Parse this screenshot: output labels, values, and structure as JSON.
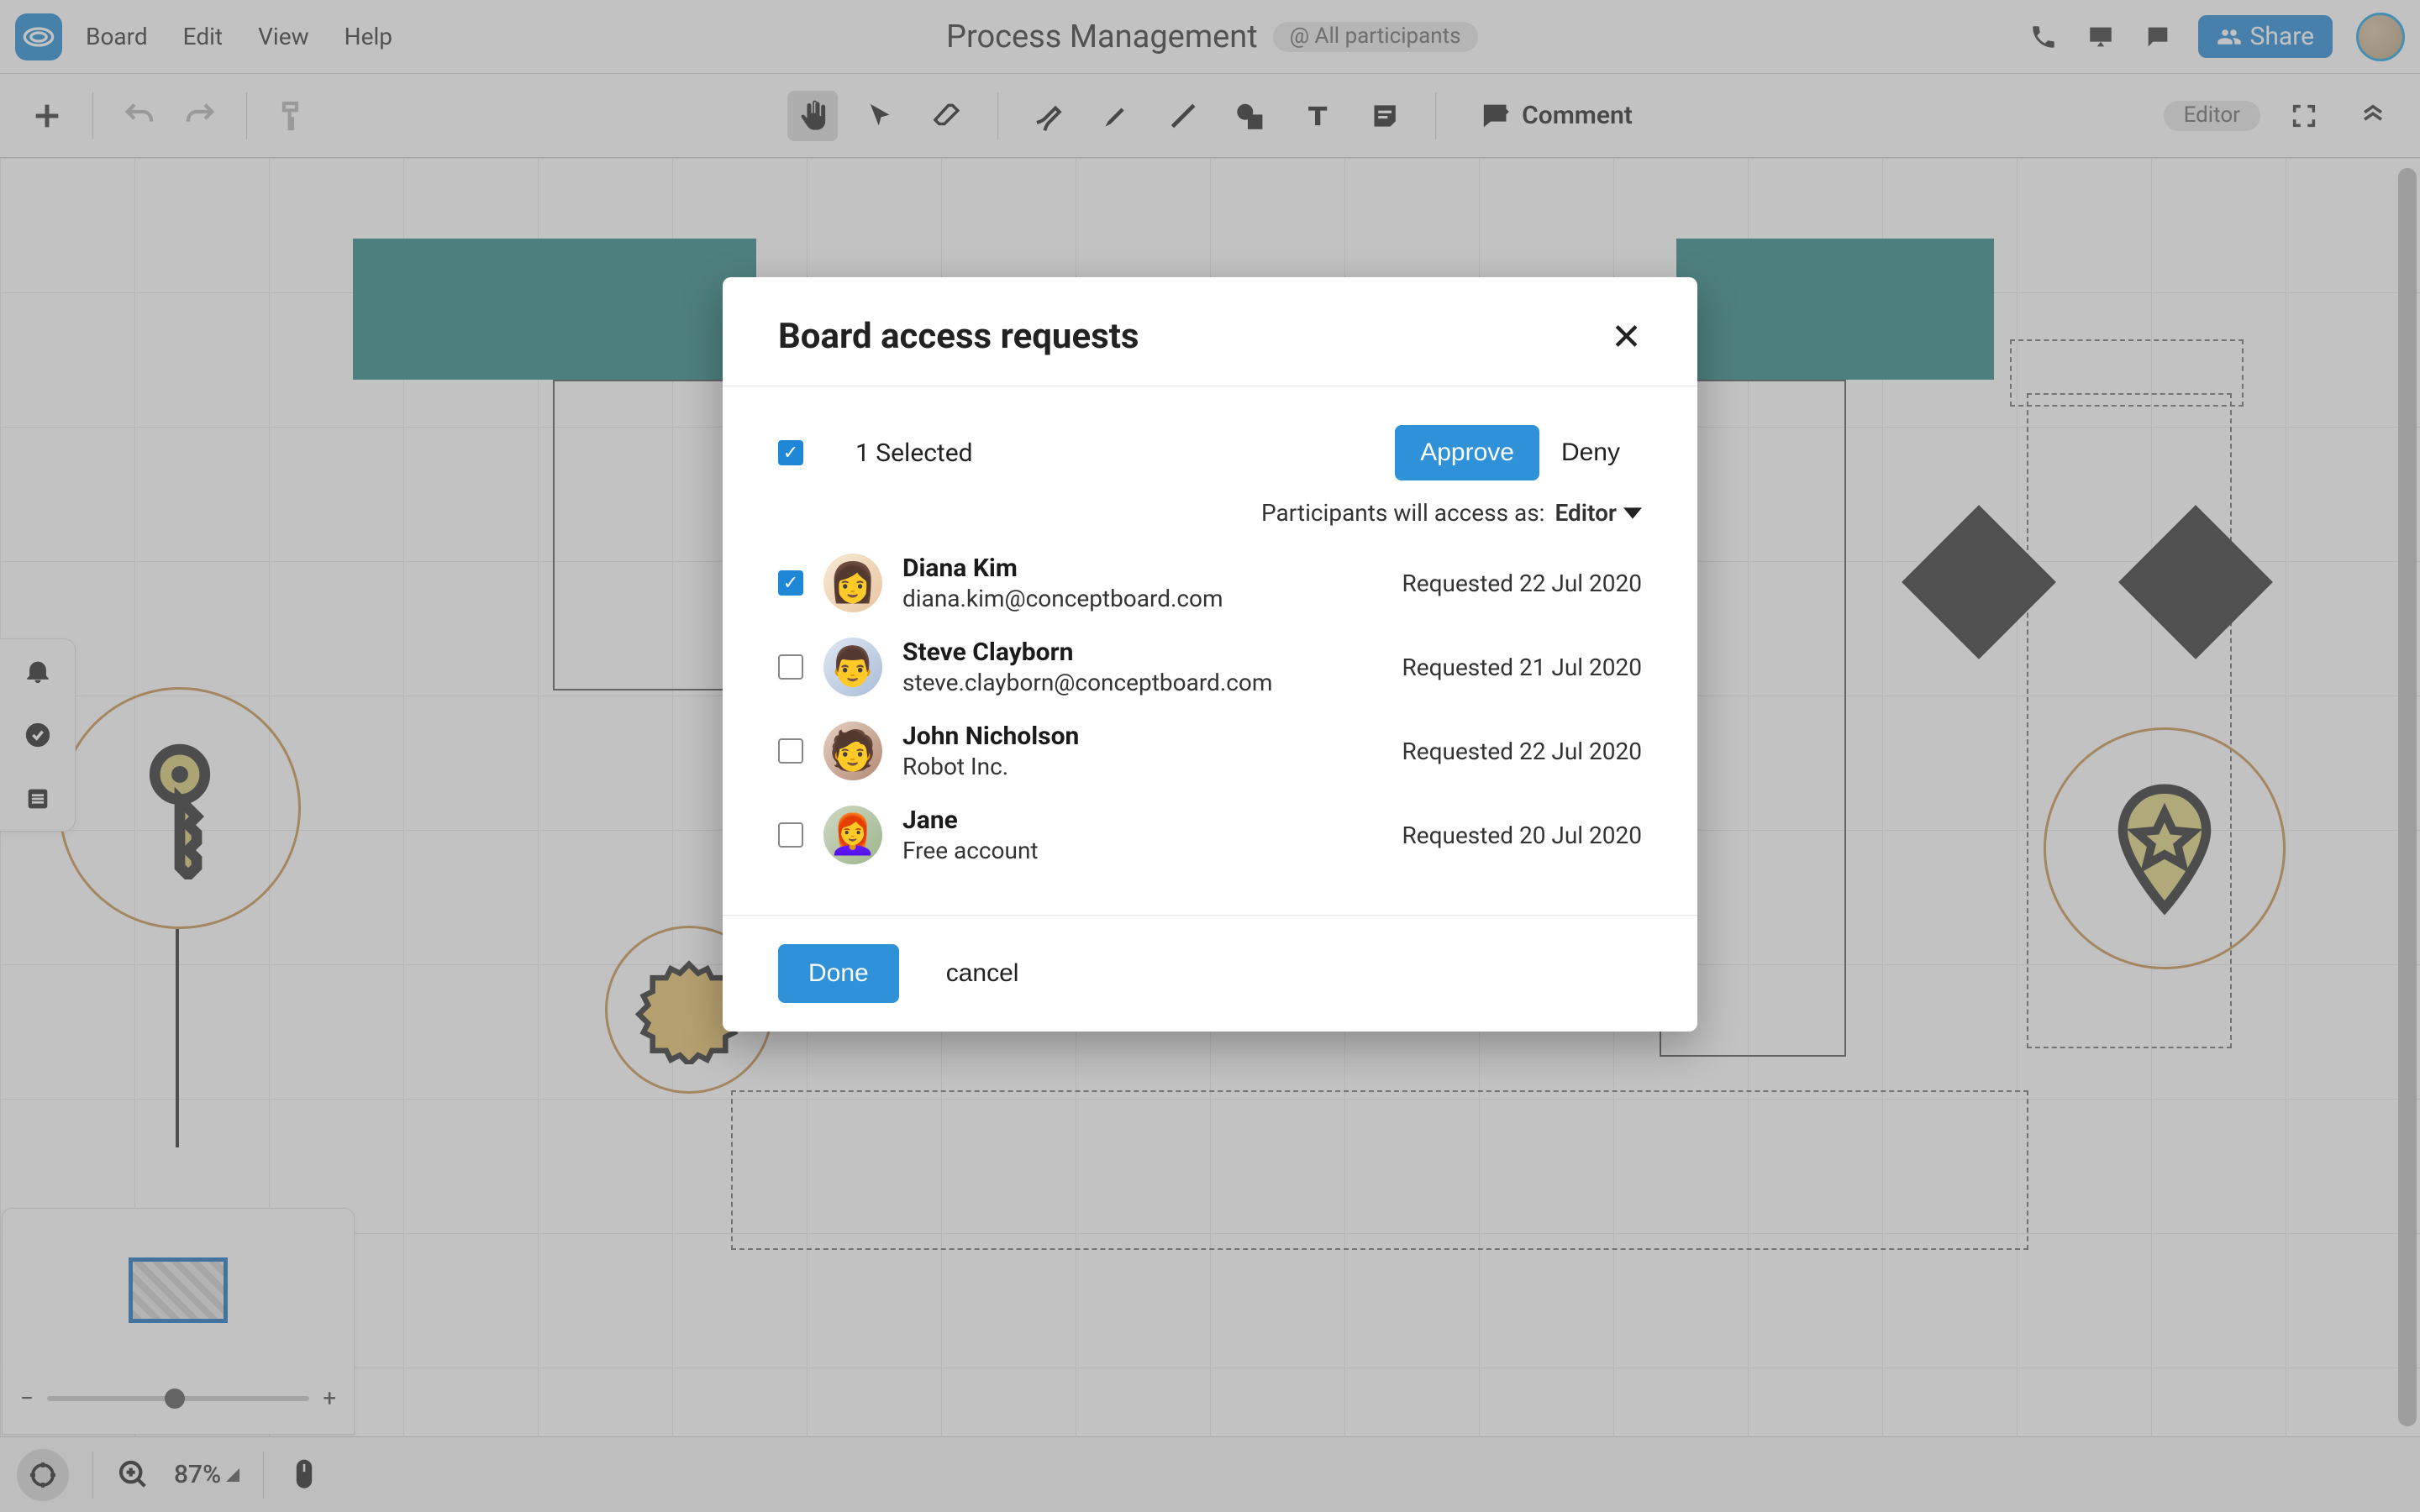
{
  "menus": {
    "board": "Board",
    "edit": "Edit",
    "view": "View",
    "help": "Help"
  },
  "document": {
    "title": "Process Management"
  },
  "participants_badge": "@ All participants",
  "share_label": "Share",
  "comment_label": "Comment",
  "role_badge": "Editor",
  "zoom_pct": "87%",
  "dialog": {
    "title": "Board access requests",
    "selected_text": "1 Selected",
    "approve": "Approve",
    "deny": "Deny",
    "access_label": "Participants will access as:",
    "access_value": "Editor",
    "done": "Done",
    "cancel": "cancel",
    "requests": [
      {
        "name": "Diana Kim",
        "sub": "diana.kim@conceptboard.com",
        "date": "Requested 22 Jul 2020",
        "checked": true
      },
      {
        "name": "Steve Clayborn",
        "sub": "steve.clayborn@conceptboard.com",
        "date": "Requested 21 Jul 2020",
        "checked": false
      },
      {
        "name": "John Nicholson",
        "sub": "Robot Inc.",
        "date": "Requested 22 Jul 2020",
        "checked": false
      },
      {
        "name": "Jane",
        "sub": "Free account",
        "date": "Requested 20 Jul 2020",
        "checked": false
      }
    ]
  }
}
